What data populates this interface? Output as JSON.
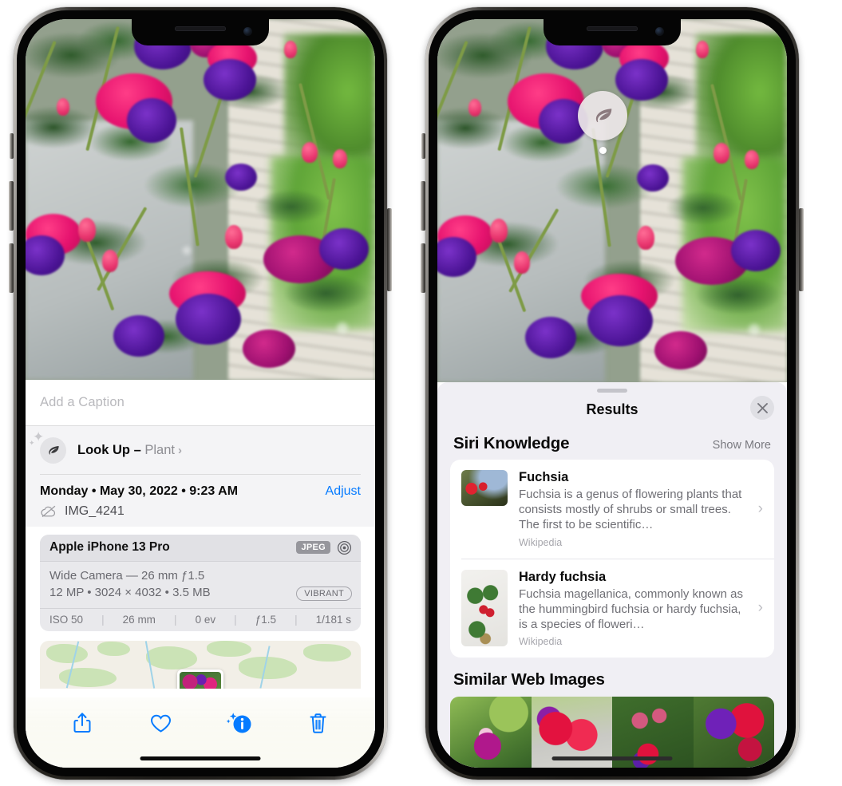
{
  "left_phone": {
    "caption_field": {
      "placeholder": "Add a Caption",
      "value": ""
    },
    "look_up": {
      "icon": "leaf-icon",
      "sparkle_icon": "sparkles-icon",
      "label": "Look Up – ",
      "subject": "Plant",
      "chevron": "›"
    },
    "metadata": {
      "date_line": "Monday • May 30, 2022 • 9:23 AM",
      "adjust_label": "Adjust",
      "cloud_icon": "cloud-slash-icon",
      "file_name": "IMG_4241"
    },
    "camera_card": {
      "model": "Apple iPhone 13 Pro",
      "format_badge": "JPEG",
      "aperture_icon": "aperture-icon",
      "lens_line": "Wide Camera — 26 mm ƒ1.5",
      "detail_line": "12 MP • 3024 × 4032 • 3.5 MB",
      "style_badge": "VIBRANT",
      "exif": [
        "ISO 50",
        "26 mm",
        "0 ev",
        "ƒ1.5",
        "1/181 s"
      ],
      "exif_divider": "|"
    },
    "toolbar": [
      {
        "name": "share-button",
        "icon": "share-icon"
      },
      {
        "name": "favorite-button",
        "icon": "heart-icon"
      },
      {
        "name": "info-button",
        "icon": "info-sparkle-icon"
      },
      {
        "name": "delete-button",
        "icon": "trash-icon"
      }
    ],
    "accent_color": "#067bff"
  },
  "right_phone": {
    "visual_lookup_pin": {
      "icon": "leaf-icon"
    },
    "sheet": {
      "grabber": "drag-handle",
      "title": "Results",
      "close_icon": "close-icon"
    },
    "siri_knowledge": {
      "section_title": "Siri Knowledge",
      "show_more_label": "Show More",
      "items": [
        {
          "title": "Fuchsia",
          "description": "Fuchsia is a genus of flowering plants that consists mostly of shrubs or small trees. The first to be scientific…",
          "source": "Wikipedia",
          "chevron": "›"
        },
        {
          "title": "Hardy fuchsia",
          "description": "Fuchsia magellanica, commonly known as the hummingbird fuchsia or hardy fuchsia, is a species of floweri…",
          "source": "Wikipedia",
          "chevron": "›"
        }
      ]
    },
    "similar_web_images": {
      "section_title": "Similar Web Images",
      "thumbnails": [
        "web-image-1",
        "web-image-2",
        "web-image-3",
        "web-image-4"
      ]
    }
  }
}
